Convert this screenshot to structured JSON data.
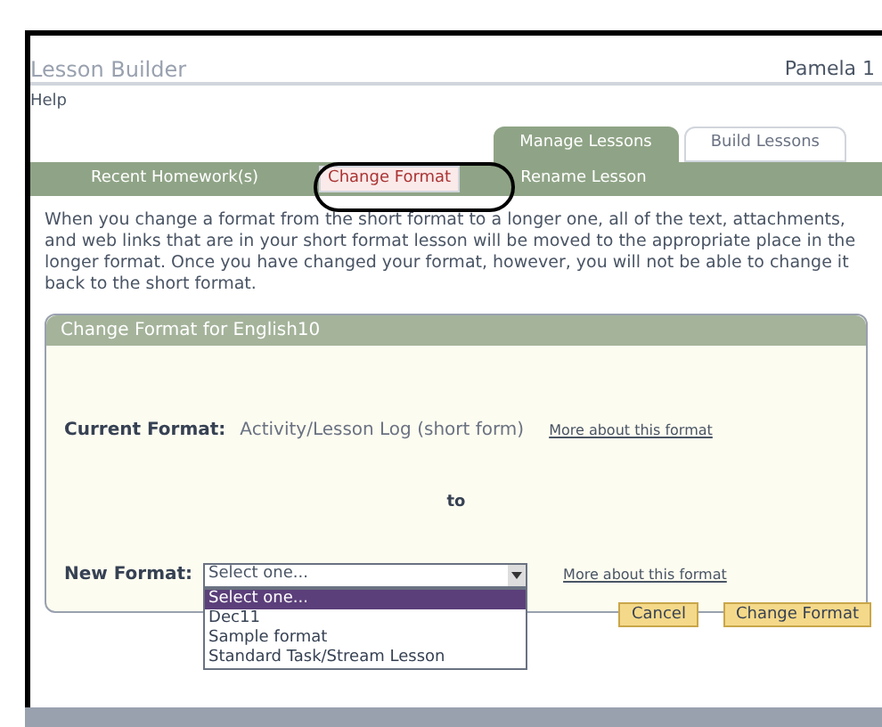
{
  "header": {
    "title": "Lesson Builder",
    "user": "Pamela 1"
  },
  "help": "Help",
  "tabs": [
    {
      "label": "Manage Lessons",
      "selected": true
    },
    {
      "label": "Build Lessons",
      "selected": false
    }
  ],
  "subnav": [
    {
      "label": "Recent Homework(s)",
      "selected": false
    },
    {
      "label": "Change Format",
      "selected": true
    },
    {
      "label": "Rename Lesson",
      "selected": false
    }
  ],
  "intro": "When you change a format from the short format to a longer one, all of the text, attachments, and web links that are in your short format lesson will be moved to the appropriate place in the longer format. Once you have changed your format, however, you will not be able to change it back to the short format.",
  "panel": {
    "title": "Change Format for English10",
    "current_label": "Current Format:",
    "current_value": "Activity/Lesson Log (short form)",
    "current_link": "More about this format",
    "to": "to",
    "new_label": "New Format:",
    "select_value": "Select one...",
    "new_link": "More about this format",
    "options": [
      {
        "label": "Select one...",
        "selected": true
      },
      {
        "label": "Dec11",
        "selected": false
      },
      {
        "label": "Sample format",
        "selected": false
      },
      {
        "label": "Standard Task/Stream Lesson",
        "selected": false
      }
    ]
  },
  "buttons": [
    "Cancel",
    "Change Format"
  ]
}
